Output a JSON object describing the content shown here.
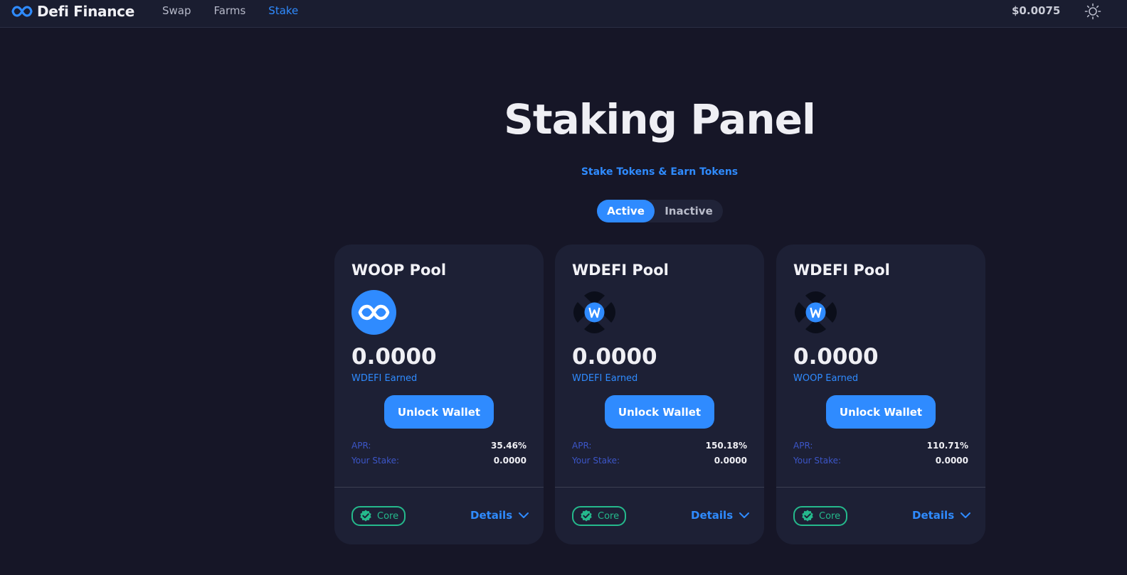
{
  "header": {
    "brand": "Defi Finance",
    "nav": [
      {
        "label": "Swap",
        "active": false
      },
      {
        "label": "Farms",
        "active": false
      },
      {
        "label": "Stake",
        "active": true
      }
    ],
    "price": "$0.0075",
    "theme_icon": "sun-icon"
  },
  "hero": {
    "title": "Staking Panel",
    "subtitle": "Stake Tokens & Earn Tokens"
  },
  "toggle": {
    "active_label": "Active",
    "inactive_label": "Inactive",
    "selected": "Active"
  },
  "labels": {
    "apr": "APR:",
    "your_stake": "Your Stake:",
    "unlock": "Unlock Wallet",
    "core": "Core",
    "details": "Details"
  },
  "pools": [
    {
      "title": "WOOP Pool",
      "icon": "woop-token-icon",
      "earned": "0.0000",
      "earned_label": "WDEFI Earned",
      "apr": "35.46%",
      "stake": "0.0000"
    },
    {
      "title": "WDEFI Pool",
      "icon": "wdefi-token-icon",
      "earned": "0.0000",
      "earned_label": "WDEFI Earned",
      "apr": "150.18%",
      "stake": "0.0000"
    },
    {
      "title": "WDEFI Pool",
      "icon": "wdefi-token-icon",
      "earned": "0.0000",
      "earned_label": "WOOP Earned",
      "apr": "110.71%",
      "stake": "0.0000"
    }
  ],
  "colors": {
    "accent": "#2f8bff",
    "background": "#161627",
    "card": "#1d2035",
    "core": "#25b98c"
  }
}
